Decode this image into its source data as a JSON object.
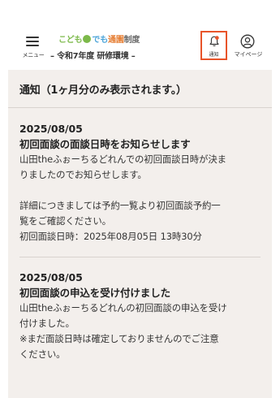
{
  "header": {
    "menu_label": "メニュー",
    "logo": {
      "part1": "こども",
      "part2": "でも",
      "part3": "通園",
      "part4": "制度",
      "badge": "誰"
    },
    "subtitle": "– 令和7年度 研修環境 –",
    "notification_label": "通知",
    "mypage_label": "マイページ"
  },
  "notifications_section": {
    "title": "通知（1ヶ月分のみ表示されます。）",
    "items": [
      {
        "date": "2025/08/05",
        "subject": "初回面談の面談日時をお知らせします",
        "lines": [
          "山田theふぉーちるどれんでの初回面談日時が決ま",
          "りましたのでお知らせします。",
          "",
          "詳細につきましては予約一覧より初回面談予約一",
          "覧をご確認ください。",
          "初回面談日時：2025年08月05日 13時30分"
        ]
      },
      {
        "date": "2025/08/05",
        "subject": "初回面談の申込を受け付けました",
        "lines": [
          "山田theふぉーちるどれんの初回面談の申込を受け",
          "付けました。",
          "※まだ面談日時は確定しておりませんのでご注意",
          "ください。"
        ]
      }
    ]
  },
  "colors": {
    "highlight_border": "#e8542a",
    "notification_dot": "#e8542a",
    "content_bg": "#f3efec",
    "logo_green": "#7cb94a",
    "logo_blue": "#4aa3d8",
    "logo_orange": "#e57b2e"
  },
  "icons": {
    "menu": "hamburger-menu-icon",
    "notification": "bell-icon",
    "mypage": "person-icon"
  }
}
